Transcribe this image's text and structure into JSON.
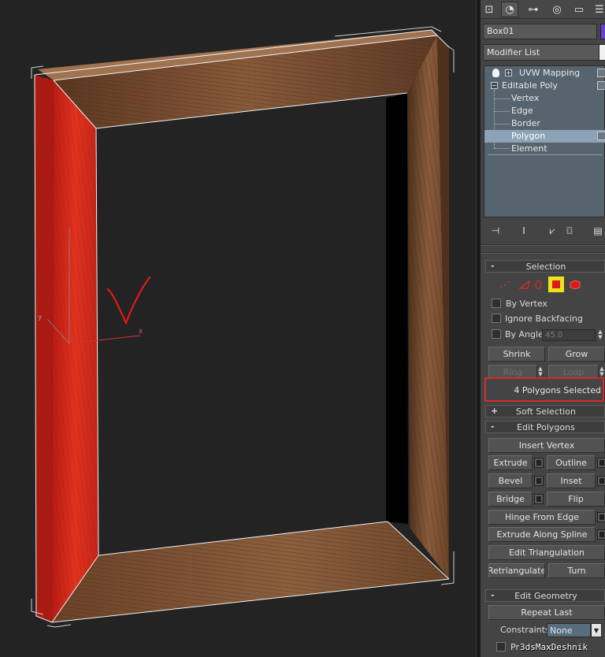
{
  "object_name": "Box01",
  "modifier_list_label": "Modifier List",
  "stack": {
    "items": [
      {
        "label": "UVW Mapping"
      },
      {
        "label": "Editable Poly"
      },
      {
        "label": "Vertex"
      },
      {
        "label": "Edge"
      },
      {
        "label": "Border"
      },
      {
        "label": "Polygon"
      },
      {
        "label": "Element"
      }
    ],
    "selected": "Polygon"
  },
  "selection_rollout": {
    "title": "Selection",
    "by_vertex": "By Vertex",
    "ignore_backfacing": "Ignore Backfacing",
    "by_angle": "By Angle:",
    "angle_value": "45.0",
    "shrink": "Shrink",
    "grow": "Grow",
    "ring": "Ring",
    "loop": "Loop",
    "status": "4 Polygons Selected"
  },
  "soft_selection": {
    "title": "Soft Selection"
  },
  "edit_polygons": {
    "title": "Edit Polygons",
    "insert_vertex": "Insert Vertex",
    "extrude": "Extrude",
    "outline": "Outline",
    "bevel": "Bevel",
    "inset": "Inset",
    "bridge": "Bridge",
    "flip": "Flip",
    "hinge_from_edge": "Hinge From Edge",
    "extrude_along_spline": "Extrude Along Spline",
    "edit_triangulation": "Edit Triangulation",
    "retriangulate": "Retriangulate",
    "turn": "Turn"
  },
  "edit_geometry": {
    "title": "Edit Geometry",
    "repeat_last": "Repeat Last",
    "constraints_label": "Constraints:",
    "constraints_value": "None",
    "preserve_uvs": "Pr"
  },
  "viewport": {
    "axis_x": "x",
    "axis_y": "y"
  },
  "watermark": "3dsMaxDeshnik",
  "colors": {
    "selected_face": "#d8271a",
    "wood": "#6b4329",
    "highlight_box": "#d62a2a",
    "checkmark": "#e01a1a"
  }
}
